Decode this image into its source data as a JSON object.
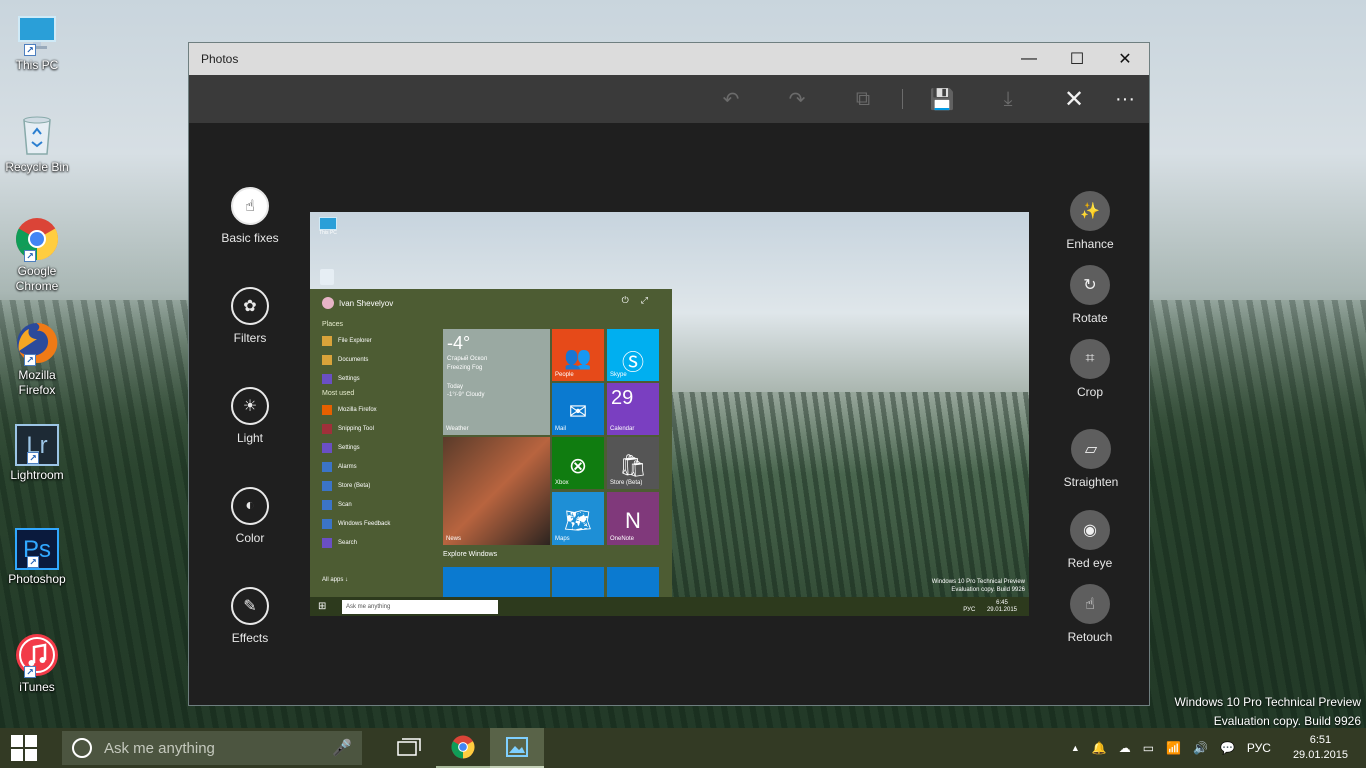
{
  "desktop": {
    "icons": [
      {
        "label": "This PC",
        "icon": "computer-icon"
      },
      {
        "label": "Recycle Bin",
        "icon": "recycle-bin-icon"
      },
      {
        "label": "Google Chrome",
        "icon": "chrome-icon"
      },
      {
        "label": "Mozilla Firefox",
        "icon": "firefox-icon"
      },
      {
        "label": "Lightroom",
        "icon_text": "Lr",
        "icon": "lightroom-icon"
      },
      {
        "label": "Photoshop",
        "icon_text": "Ps",
        "icon": "photoshop-icon"
      },
      {
        "label": "iTunes",
        "icon": "itunes-icon"
      }
    ],
    "watermark": {
      "line1": "Windows 10 Pro Technical Preview",
      "line2": "Evaluation copy. Build 9926"
    }
  },
  "window": {
    "title": "Photos",
    "controls": {
      "minimize": "—",
      "maximize": "☐",
      "close": "✕"
    },
    "toolbar": {
      "undo": "↶",
      "redo": "↷",
      "compare": "⧉",
      "save": "💾",
      "save_copy": "⤓",
      "cancel": "✕",
      "more": "···"
    },
    "left_tools": [
      {
        "label": "Basic fixes",
        "glyph": "☝",
        "selected": true
      },
      {
        "label": "Filters",
        "glyph": "✿"
      },
      {
        "label": "Light",
        "glyph": "☀"
      },
      {
        "label": "Color",
        "glyph": "◐"
      },
      {
        "label": "Effects",
        "glyph": "✎"
      }
    ],
    "right_tools": [
      {
        "label": "Enhance",
        "glyph": "✨"
      },
      {
        "label": "Rotate",
        "glyph": "↻"
      },
      {
        "label": "Crop",
        "glyph": "⌗"
      },
      {
        "label": "Straighten",
        "glyph": "▱"
      },
      {
        "label": "Red eye",
        "glyph": "◉"
      },
      {
        "label": "Retouch",
        "glyph": "☝"
      }
    ]
  },
  "photo": {
    "desktop_icon_label": "This PC",
    "start_menu": {
      "user": "Ivan Shevelyov",
      "places_header": "Places",
      "places": [
        "File Explorer",
        "Documents",
        "Settings"
      ],
      "most_used_header": "Most used",
      "most_used": [
        "Mozilla Firefox",
        "Snipping Tool",
        "Settings",
        "Alarms",
        "Store (Beta)",
        "Scan",
        "Windows Feedback",
        "Search"
      ],
      "all_apps": "All apps ↓",
      "explore": "Explore Windows",
      "weather": {
        "temp": "-4°",
        "line1": "Старый Оскол",
        "line2": "Freezing Fog",
        "line3": "Today",
        "line4": "-1°/-9° Cloudy",
        "label": "Weather"
      },
      "tiles": {
        "people": "People",
        "skype": "Skype",
        "mail": "Mail",
        "calendar": "Calendar",
        "calendar_day": "29",
        "news": "News",
        "xbox": "Xbox",
        "store": "Store (Beta)",
        "maps": "Maps",
        "onenote": "OneNote"
      }
    },
    "taskbar": {
      "search": "Ask me anything",
      "lang": "РУС",
      "time": "6:45",
      "date": "29.01.2015"
    },
    "watermark": {
      "line1": "Windows 10 Pro Technical Preview",
      "line2": "Evaluation copy. Build 9926"
    }
  },
  "taskbar": {
    "search_placeholder": "Ask me anything",
    "lang": "РУС",
    "time": "6:51",
    "date": "29.01.2015",
    "tray_icons": [
      "▲",
      "🔔",
      "☁",
      "▭",
      "📶",
      "🔊",
      "💬"
    ]
  }
}
